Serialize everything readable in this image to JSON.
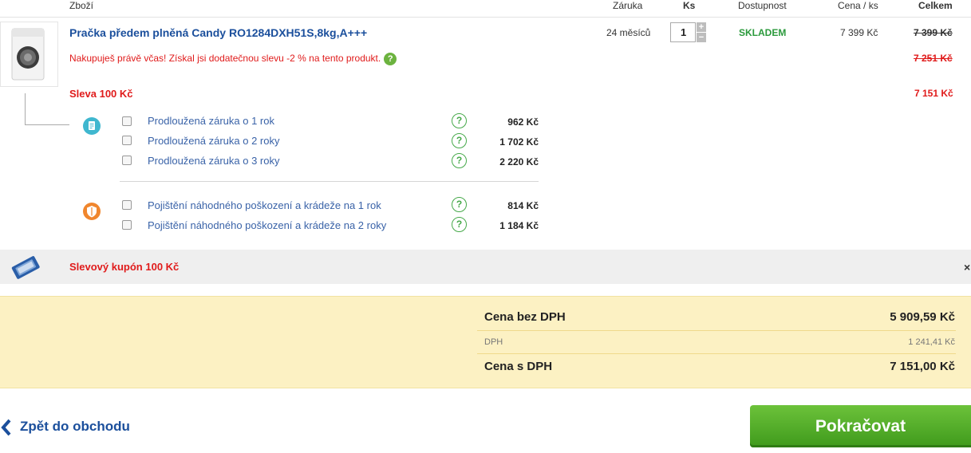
{
  "header": {
    "col_product": "Zboží",
    "col_warranty": "Záruka",
    "col_qty": "Ks",
    "col_availability": "Dostupnost",
    "col_unit_price": "Cena / ks",
    "col_total": "Celkem"
  },
  "product": {
    "title": "Pračka předem plněná Candy RO1284DXH51S,8kg,A+++",
    "info": "Nakupuješ právě včas! Získal jsi dodatečnou slevu -2 % na tento produkt.",
    "help_icon": "question-icon",
    "warranty": "24 měsíců",
    "quantity": "1",
    "availability": "SKLADEM",
    "unit_price": "7 399 Kč",
    "total_original": "7 399 Kč",
    "total_after_info": "7 251 Kč",
    "discount_label": "Sleva 100 Kč",
    "discount_total": "7 151 Kč"
  },
  "services": {
    "warranty_group": [
      {
        "label": "Prodloužená záruka o 1 rok",
        "price": "962 Kč"
      },
      {
        "label": "Prodloužená záruka o 2 roky",
        "price": "1 702 Kč"
      },
      {
        "label": "Prodloužená záruka o 3 roky",
        "price": "2 220 Kč"
      }
    ],
    "insurance_group": [
      {
        "label": "Pojištění náhodného poškození a krádeže na 1 rok",
        "price": "814 Kč"
      },
      {
        "label": "Pojištění náhodného poškození a krádeže na 2 roky",
        "price": "1 184 Kč"
      }
    ],
    "question_mark": "?"
  },
  "coupon": {
    "label": "Slevový kupón 100 Kč",
    "close": "×"
  },
  "summary": {
    "net_label": "Cena bez DPH",
    "net_value": "5 909,59 Kč",
    "vat_label": "DPH",
    "vat_value": "1 241,41 Kč",
    "gross_label": "Cena s DPH",
    "gross_value": "7 151,00 Kč"
  },
  "actions": {
    "back": "Zpět do obchodu",
    "continue": "Pokračovat"
  },
  "colors": {
    "link_blue": "#1b4f9c",
    "sale_red": "#e01b1b",
    "stock_green": "#2b9a3c",
    "summary_bg": "#fcf1c3",
    "continue_green": "#4fa826"
  }
}
